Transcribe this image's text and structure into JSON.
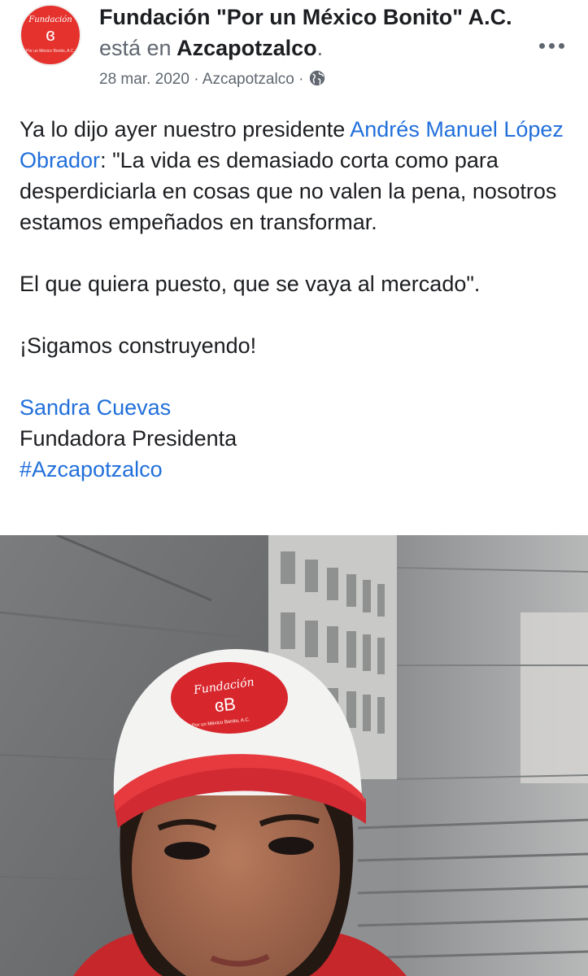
{
  "post": {
    "avatar": {
      "logo_top": "Fundación",
      "logo_mark": "ɞ",
      "logo_bottom": "Por un México Bonito, A.C."
    },
    "author": "Fundación \"Por un México Bonito\" A.C.",
    "location_prefix": "está en",
    "location": "Azcapotzalco",
    "location_suffix": ".",
    "date": "28 mar. 2020",
    "separator": "·",
    "meta_location": "Azcapotzalco",
    "privacy_icon": "globe-icon",
    "more_icon": "more-options-icon",
    "body": {
      "intro": "Ya lo dijo ayer nuestro presidente ",
      "mention": "Andrés Manuel López Obrador",
      "quote": ": \"La vida es demasiado corta como para desperdiciarla en cosas que no valen la pena, nosotros estamos empeñados en transformar.",
      "quote2": "El que quiera puesto, que se vaya al mercado\".",
      "cta": "¡Sigamos construyendo!",
      "signature_name": "Sandra Cuevas",
      "signature_title": "Fundadora Presidenta",
      "hashtag": "#Azcapotzalco"
    },
    "photo": {
      "cap_text": "Fundación",
      "cap_logo": "ɞB",
      "cap_subtext": "Por un México Bonito, A.C."
    }
  },
  "colors": {
    "link": "#216fdb",
    "brand_red": "#e5322d",
    "meta_gray": "#606770"
  }
}
